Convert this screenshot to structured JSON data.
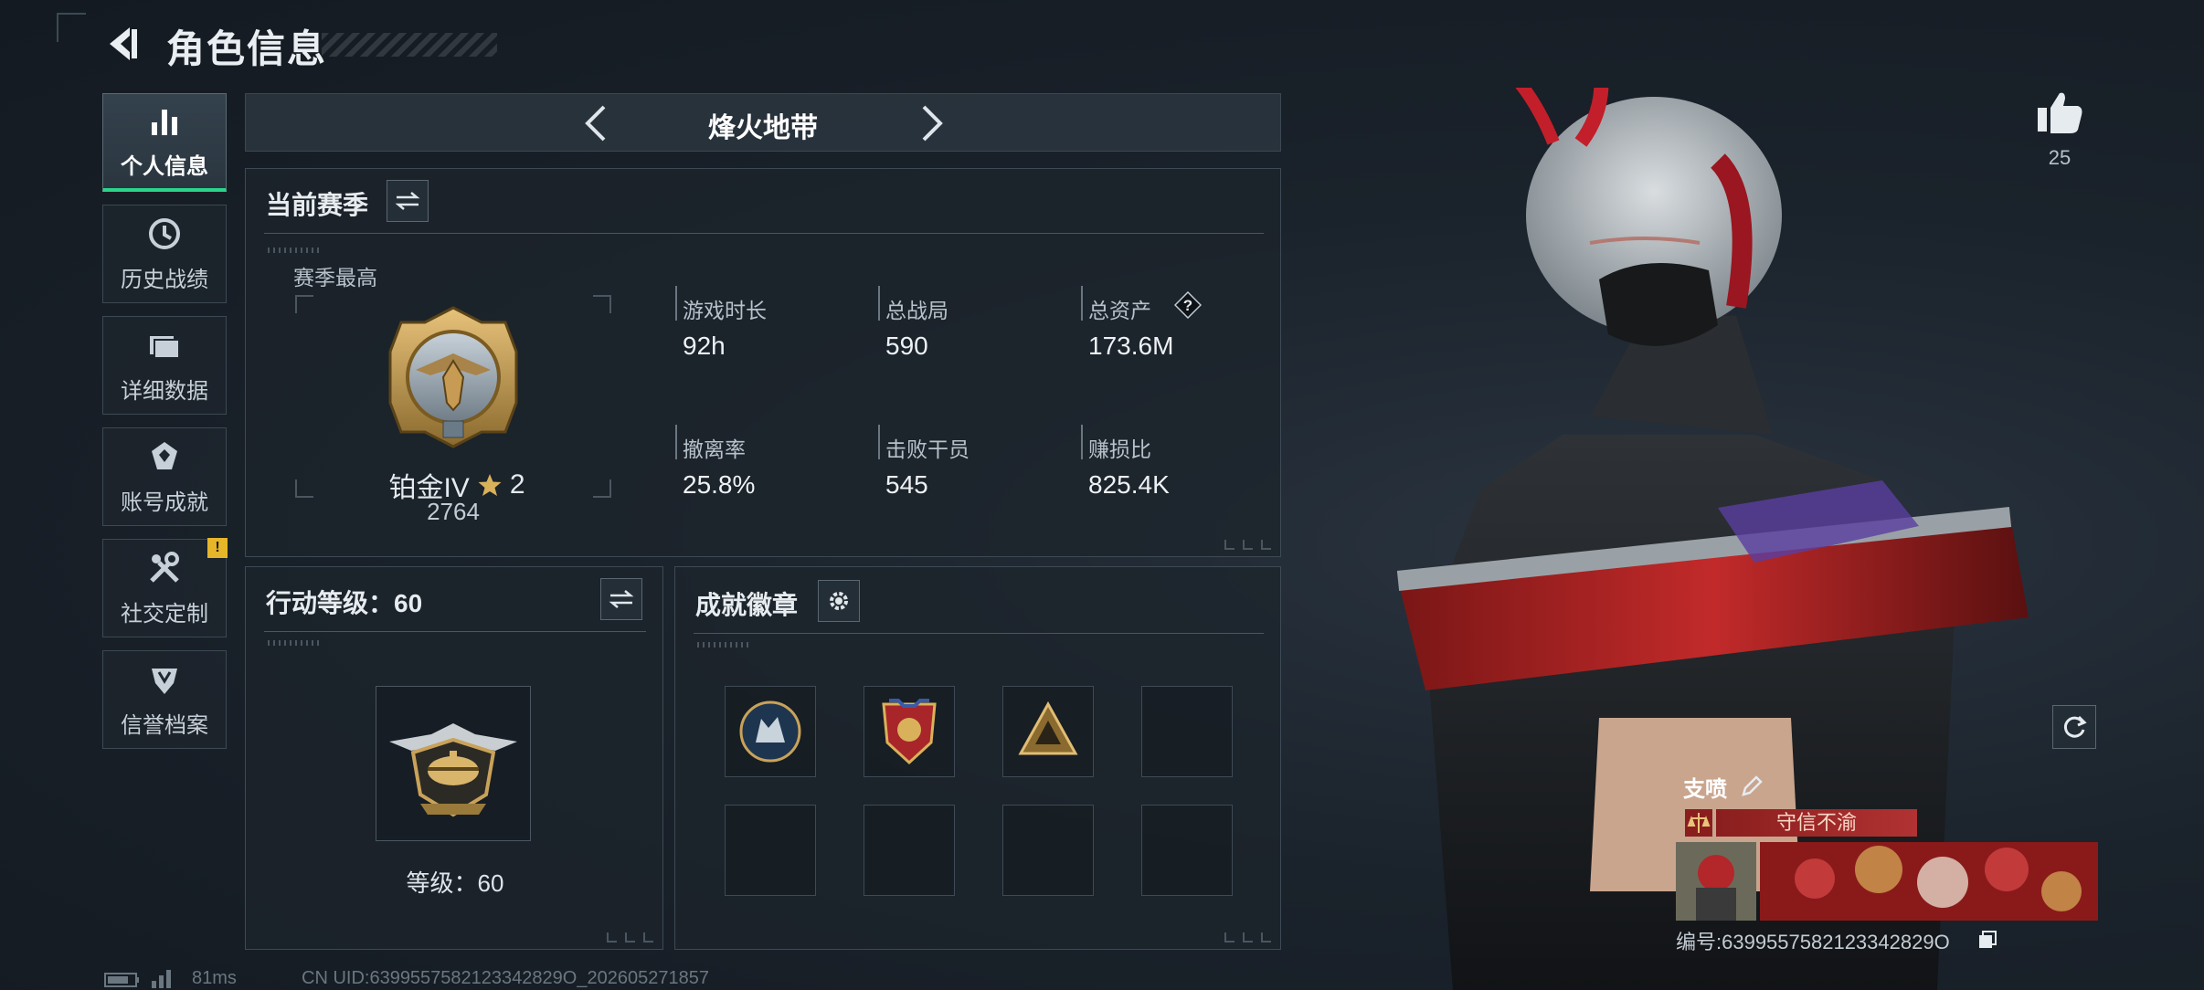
{
  "header": {
    "title": "角色信息"
  },
  "sidebar": {
    "items": [
      {
        "label": "个人信息",
        "icon": "bar-chart-icon",
        "active": true
      },
      {
        "label": "历史战绩",
        "icon": "history-icon"
      },
      {
        "label": "详细数据",
        "icon": "folder-icon"
      },
      {
        "label": "账号成就",
        "icon": "achievement-icon"
      },
      {
        "label": "社交定制",
        "icon": "tools-icon",
        "badge": "!"
      },
      {
        "label": "信誉档案",
        "icon": "credit-shield-icon"
      }
    ]
  },
  "mode": {
    "name": "烽火地带"
  },
  "season": {
    "title": "当前赛季",
    "best_label": "赛季最高",
    "rank_name": "铂金IV",
    "rank_stars": "2",
    "rank_points": "2764",
    "stats": [
      {
        "label": "游戏时长",
        "value": "92h"
      },
      {
        "label": "总战局",
        "value": "590"
      },
      {
        "label": "总资产",
        "value": "173.6M",
        "help": "?"
      },
      {
        "label": "撤离率",
        "value": "25.8%"
      },
      {
        "label": "击败干员",
        "value": "545"
      },
      {
        "label": "赚损比",
        "value": "825.4K"
      }
    ]
  },
  "action_level": {
    "title": "行动等级：60",
    "level_text": "等级：60"
  },
  "achievements": {
    "title": "成就徽章"
  },
  "profile": {
    "likes": "25"
  },
  "spray": {
    "title": "支喷",
    "tag": "守信不渝",
    "id_text": "编号:6399557582123342829O"
  },
  "footer": {
    "ping": "81ms",
    "uid": "CN UID:6399557582123342829O_202605271857"
  },
  "colors": {
    "accent": "#2bd48a",
    "badge": "#e6b52a",
    "tag_red": "#b13232"
  }
}
